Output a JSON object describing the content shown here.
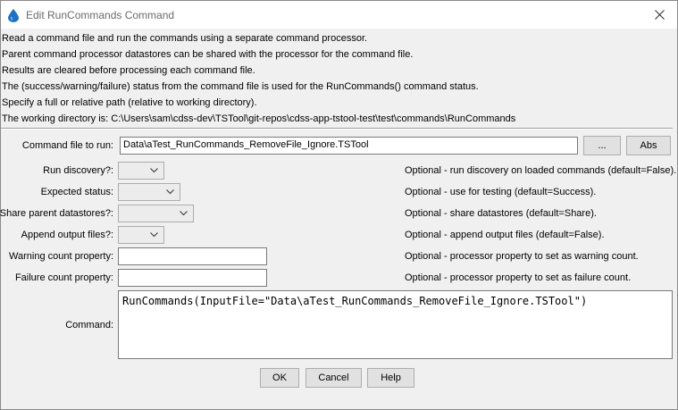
{
  "window": {
    "title": "Edit RunCommands Command"
  },
  "description": [
    "Read a command file and run the commands using a separate command processor.",
    "Parent command processor datastores can be shared with the processor for the command file.",
    "Results are cleared before processing each command file.",
    "The (success/warning/failure) status from the command file is used for the RunCommands() command status.",
    "Specify a full or relative path (relative to working directory).",
    "The working directory is: C:\\Users\\sam\\cdss-dev\\TSTool\\git-repos\\cdss-app-tstool-test\\test\\commands\\RunCommands"
  ],
  "form": {
    "command_file": {
      "label": "Command file to run:",
      "value": "Data\\aTest_RunCommands_RemoveFile_Ignore.TSTool",
      "browse_label": "...",
      "abs_label": "Abs"
    },
    "run_discovery": {
      "label": "Run discovery?:",
      "value": "",
      "hint": "Optional - run discovery on loaded commands (default=False)."
    },
    "expected_status": {
      "label": "Expected status:",
      "value": "",
      "hint": "Optional - use for testing (default=Success)."
    },
    "share_datastores": {
      "label": "Share parent datastores?:",
      "value": "",
      "hint": "Optional - share datastores (default=Share)."
    },
    "append_output": {
      "label": "Append output files?:",
      "value": "",
      "hint": "Optional - append output files (default=False)."
    },
    "warning_count": {
      "label": "Warning count property:",
      "value": "",
      "hint": "Optional - processor property to set as warning count."
    },
    "failure_count": {
      "label": "Failure count property:",
      "value": "",
      "hint": "Optional - processor property to set as failure count."
    },
    "command": {
      "label": "Command:",
      "value": "RunCommands(InputFile=\"Data\\aTest_RunCommands_RemoveFile_Ignore.TSTool\")"
    }
  },
  "buttons": {
    "ok": "OK",
    "cancel": "Cancel",
    "help": "Help"
  },
  "colors": {
    "window_bg": "#f0f0f0",
    "app_icon": "#1a73c8"
  }
}
